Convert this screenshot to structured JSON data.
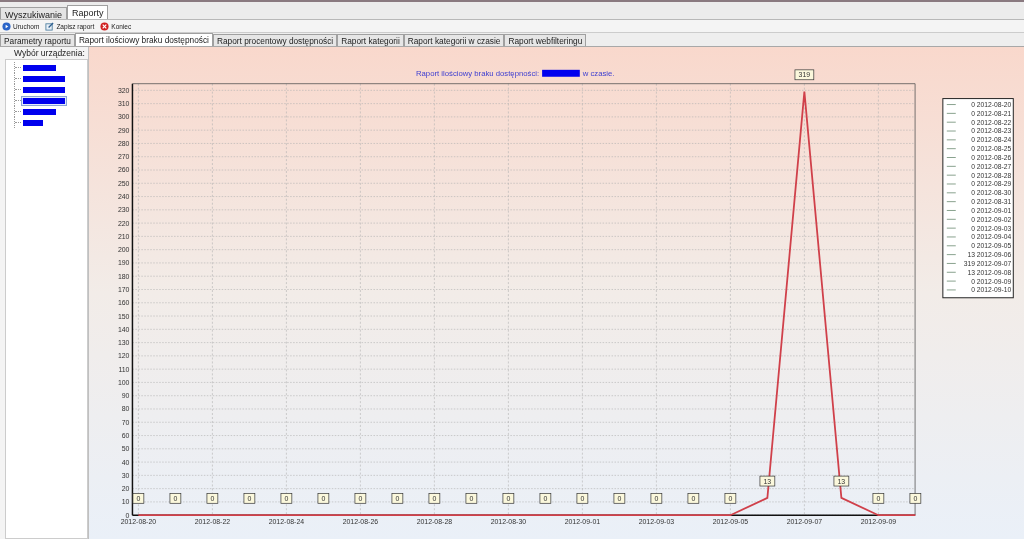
{
  "main_tabs": [
    {
      "label": "Wyszukiwanie",
      "selected": false
    },
    {
      "label": "Raporty",
      "selected": true
    }
  ],
  "toolbar": [
    {
      "kind": "run",
      "label": "Uruchom"
    },
    {
      "kind": "save",
      "label": "Zapisz raport"
    },
    {
      "kind": "close",
      "label": "Koniec"
    }
  ],
  "report_tabs": [
    {
      "label": "Parametry raportu",
      "selected": false
    },
    {
      "label": "Raport ilościowy braku dostępności",
      "selected": true
    },
    {
      "label": "Raport procentowy dostępności",
      "selected": false
    },
    {
      "label": "Raport kategorii",
      "selected": false
    },
    {
      "label": "Raport kategorii w czasie",
      "selected": false
    },
    {
      "label": "Raport webfilteringu",
      "selected": false
    }
  ],
  "device_panel": {
    "label": "Wybór urządzenia:",
    "items": [
      {
        "selected": false
      },
      {
        "selected": false
      },
      {
        "selected": false
      },
      {
        "selected": true
      },
      {
        "selected": false
      },
      {
        "selected": false
      }
    ]
  },
  "chart": {
    "title_before": "Raport ilościowy braku dostępności:",
    "title_after": "w czasie.",
    "legend": [
      "0 2012-08-20",
      "0 2012-08-21",
      "0 2012-08-22",
      "0 2012-08-23",
      "0 2012-08-24",
      "0 2012-08-25",
      "0 2012-08-26",
      "0 2012-08-27",
      "0 2012-08-28",
      "0 2012-08-29",
      "0 2012-08-30",
      "0 2012-08-31",
      "0 2012-09-01",
      "0 2012-09-02",
      "0 2012-09-03",
      "0 2012-09-04",
      "0 2012-09-05",
      "13 2012-09-06",
      "319 2012-09-07",
      "13 2012-09-08",
      "0 2012-09-09",
      "0 2012-09-10"
    ],
    "chart_data": {
      "type": "line",
      "categories": [
        "2012-08-20",
        null,
        "2012-08-22",
        null,
        "2012-08-24",
        null,
        "2012-08-26",
        null,
        "2012-08-28",
        null,
        "2012-08-30",
        null,
        "2012-09-01",
        null,
        "2012-09-03",
        null,
        "2012-09-05",
        null,
        "2012-09-07",
        null,
        "2012-09-09",
        null
      ],
      "grid": true,
      "series": [
        {
          "color": "#d0404a",
          "values": [
            0,
            0,
            0,
            0,
            0,
            0,
            0,
            0,
            0,
            0,
            0,
            0,
            0,
            0,
            0,
            0,
            0,
            13,
            319,
            13,
            0,
            0
          ]
        }
      ],
      "ylim": [
        0,
        325
      ],
      "yticks": [
        0,
        10,
        20,
        30,
        40,
        50,
        60,
        70,
        80,
        90,
        100,
        110,
        120,
        130,
        140,
        150,
        160,
        170,
        180,
        190,
        200,
        210,
        220,
        230,
        240,
        250,
        260,
        270,
        280,
        290,
        300,
        310,
        320
      ],
      "data_labels": true
    }
  }
}
